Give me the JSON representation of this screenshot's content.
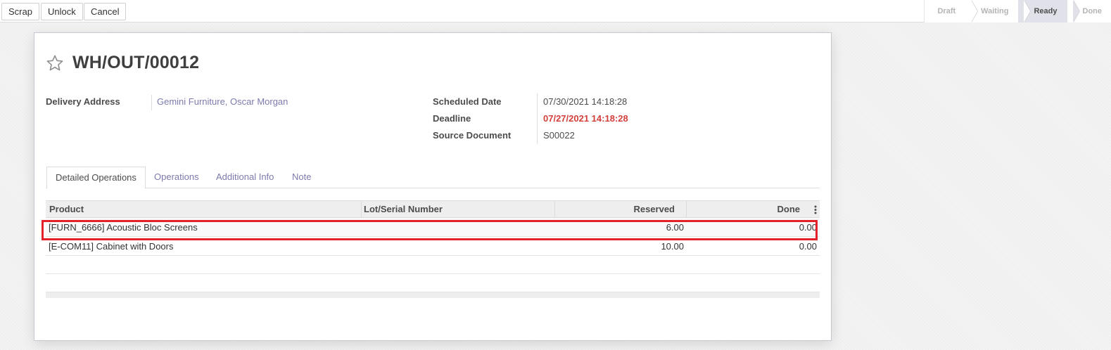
{
  "toolbar": {
    "scrap_label": "Scrap",
    "unlock_label": "Unlock",
    "cancel_label": "Cancel"
  },
  "statusbar": {
    "stages": [
      "Draft",
      "Waiting",
      "Ready",
      "Done"
    ],
    "active": "Ready"
  },
  "record": {
    "title": "WH/OUT/00012",
    "delivery_address_label": "Delivery Address",
    "delivery_address": "Gemini Furniture, Oscar Morgan",
    "scheduled_date_label": "Scheduled Date",
    "scheduled_date": "07/30/2021 14:18:28",
    "deadline_label": "Deadline",
    "deadline": "07/27/2021 14:18:28",
    "source_document_label": "Source Document",
    "source_document": "S00022"
  },
  "tabs": [
    "Detailed Operations",
    "Operations",
    "Additional Info",
    "Note"
  ],
  "table": {
    "columns": [
      "Product",
      "Lot/Serial Number",
      "Reserved",
      "Done"
    ],
    "rows": [
      {
        "product": "[FURN_6666] Acoustic Bloc Screens",
        "lot": "",
        "reserved": "6.00",
        "done": "0.00"
      },
      {
        "product": "[E-COM11] Cabinet with Doors",
        "lot": "",
        "reserved": "10.00",
        "done": "0.00"
      }
    ]
  },
  "colors": {
    "link": "#7c7bad",
    "overdue": "#d23f3a",
    "highlight_box": "#e3212b",
    "active_stage_bg": "#e1e2e9"
  }
}
